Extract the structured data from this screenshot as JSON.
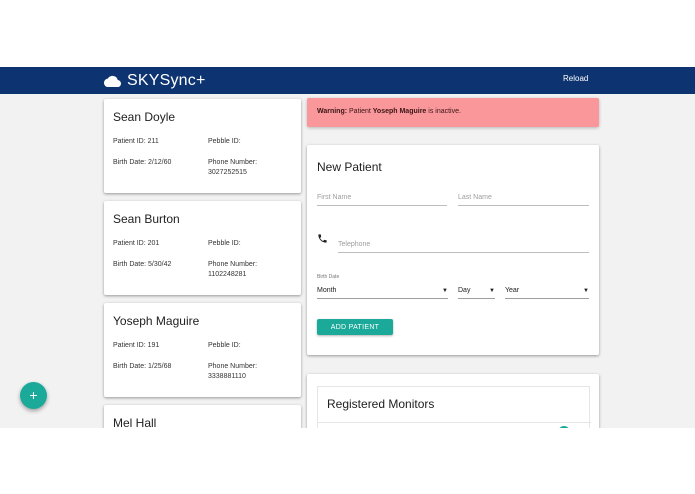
{
  "header": {
    "brand": "SKYSync+",
    "reload_label": "Reload",
    "color": "#0d3470"
  },
  "patients": [
    {
      "name": "Sean Doyle",
      "patient_id": "Patient ID: 211",
      "pebble_id": "Pebble ID:",
      "birth_date": "Birth Date: 2/12/60",
      "phone_label": "Phone Number:",
      "phone": "3027252515"
    },
    {
      "name": "Sean Burton",
      "patient_id": "Patient ID: 201",
      "pebble_id": "Pebble ID:",
      "birth_date": "Birth Date: 5/30/42",
      "phone_label": "Phone Number:",
      "phone": "1102248281"
    },
    {
      "name": "Yoseph Maguire",
      "patient_id": "Patient ID: 191",
      "pebble_id": "Pebble ID:",
      "birth_date": "Birth Date: 1/25/68",
      "phone_label": "Phone Number:",
      "phone": "3338881110"
    },
    {
      "name": "Mel Hall"
    }
  ],
  "warning": {
    "prefix": "Warning: ",
    "middle": "Patient ",
    "patient": "Yoseph Maguire",
    "suffix": " is inactive.",
    "color": "#f9979a"
  },
  "new_patient": {
    "title": "New Patient",
    "first_name_placeholder": "First Name",
    "last_name_placeholder": "Last Name",
    "telephone_placeholder": "Telephone",
    "birth_date_label": "Birth Date",
    "month_value": "Month",
    "day_value": "Day",
    "year_value": "Year",
    "add_button": "ADD PATIENT"
  },
  "monitors": {
    "title": "Registered Monitors"
  },
  "fab": {
    "label": "+",
    "color": "#1ba99a"
  },
  "icons": {
    "brand": "cloud-icon",
    "phone": "phone-icon",
    "dropdown": "dropdown-arrow-icon"
  }
}
